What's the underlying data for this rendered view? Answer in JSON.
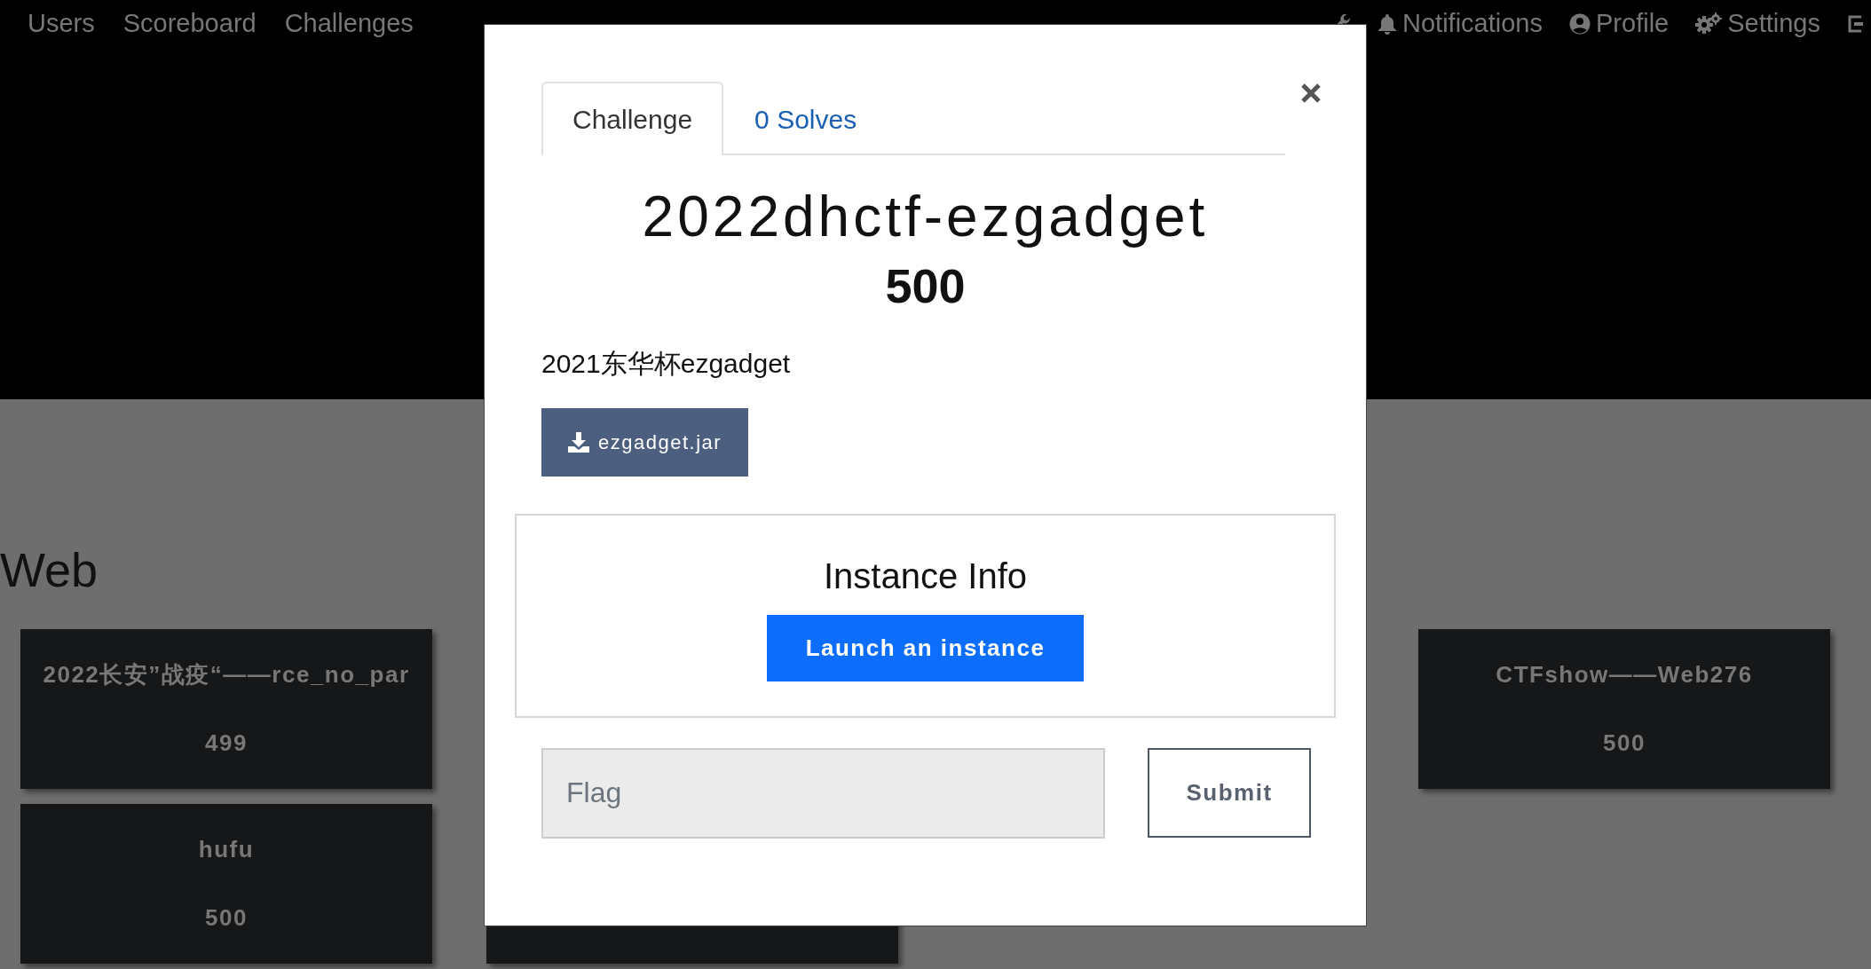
{
  "navbar": {
    "left_items": [
      {
        "label": "Users"
      },
      {
        "label": "Scoreboard"
      },
      {
        "label": "Challenges"
      }
    ],
    "right_items": [
      {
        "kind": "icon"
      },
      {
        "kind": "link",
        "label": "Notifications"
      },
      {
        "kind": "link",
        "label": "Profile"
      },
      {
        "kind": "link",
        "label": "Settings"
      },
      {
        "kind": "icon"
      }
    ]
  },
  "category": {
    "title": "Web",
    "challenges": [
      {
        "kind": "shown",
        "name": "2022长安”战疫“——rce_no_par",
        "value": "499"
      },
      {
        "kind": "shown",
        "name": "CTFshow——Web276",
        "value": "500"
      },
      {
        "kind": "shown",
        "name": "hufu",
        "value": "500"
      },
      {
        "kind": "covered"
      }
    ]
  },
  "modal": {
    "tabs": [
      {
        "label": "Challenge",
        "selected": true
      },
      {
        "label": "0 Solves",
        "selected": false
      }
    ],
    "title": "2022dhctf-ezgadget",
    "value": "500",
    "description": "2021东华杯ezgadget",
    "files": [
      {
        "label": "ezgadget.jar"
      }
    ],
    "instance": {
      "title": "Instance Info",
      "button": "Launch an instance"
    },
    "flag": {
      "placeholder": "Flag"
    },
    "submit": "Submit"
  }
}
